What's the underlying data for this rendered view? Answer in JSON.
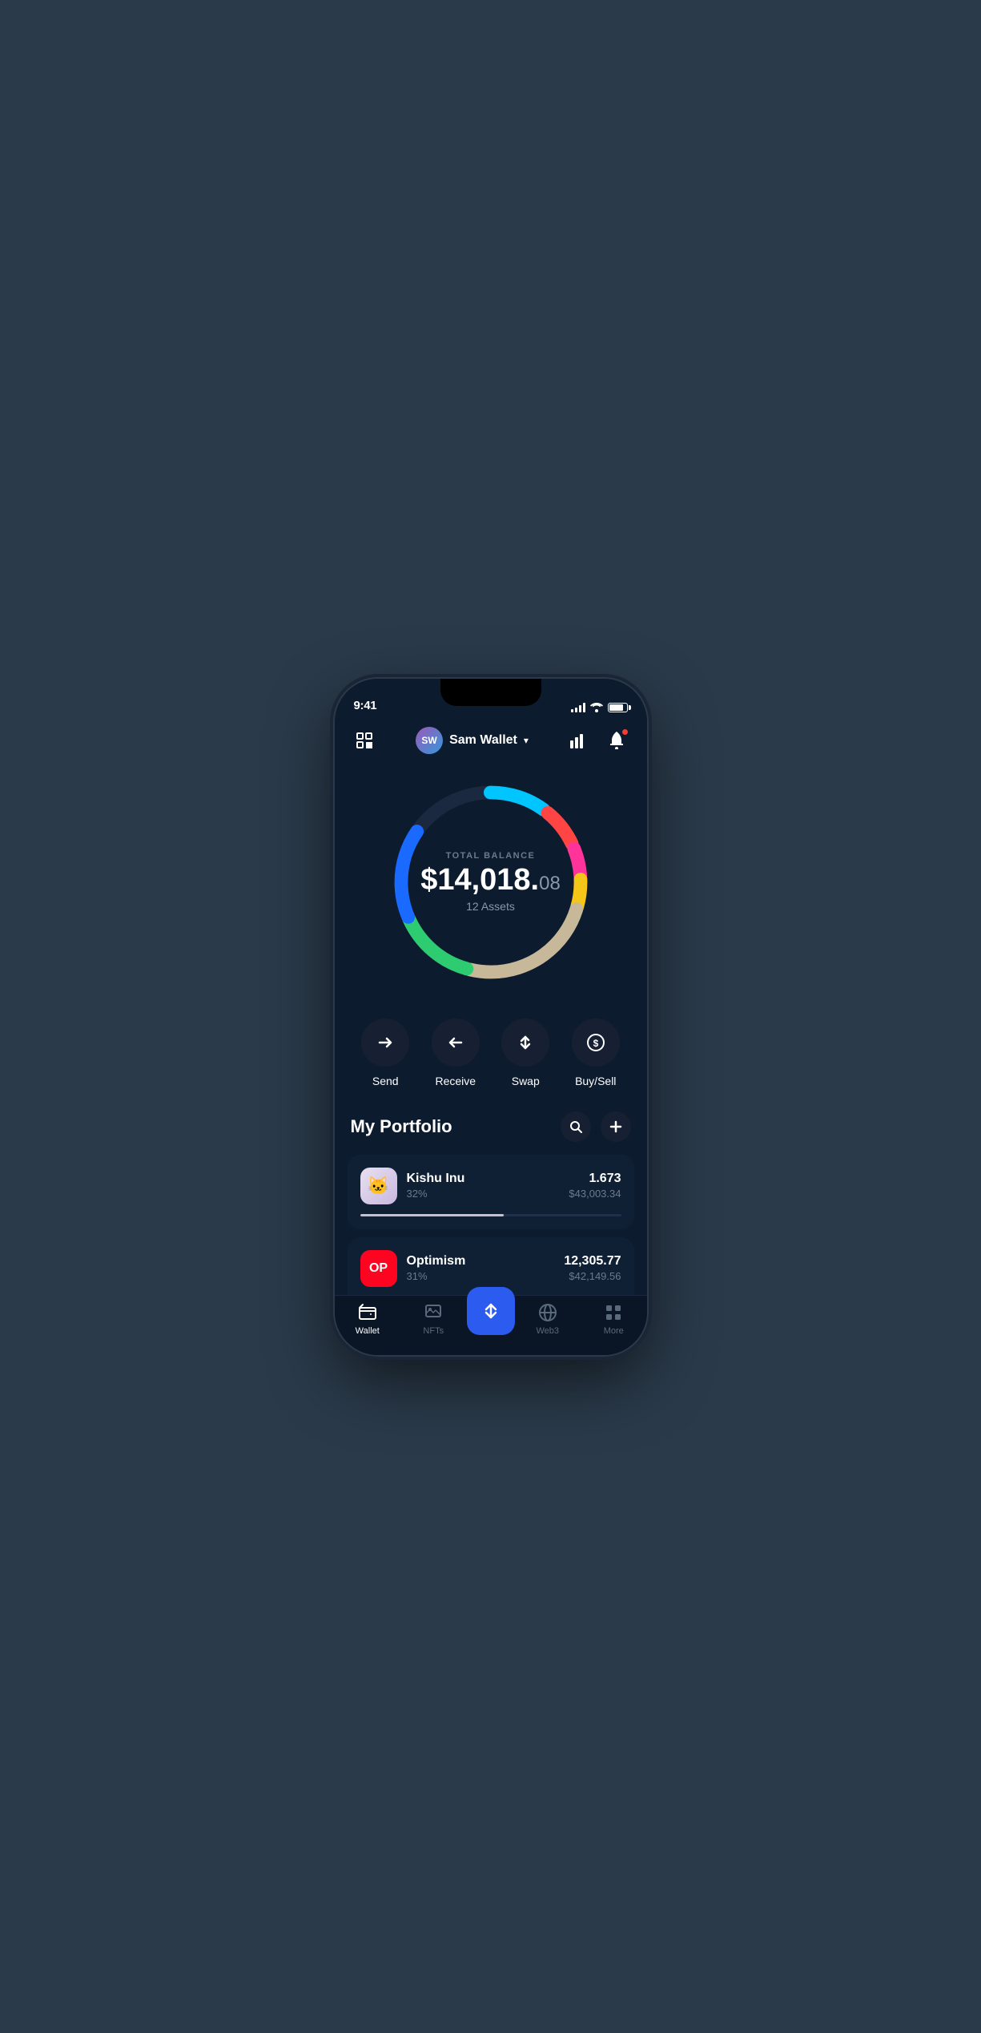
{
  "statusBar": {
    "time": "9:41",
    "batteryLevel": 85
  },
  "header": {
    "scanLabel": "scan",
    "walletName": "Sam Wallet",
    "avatarInitials": "SW",
    "analyticsLabel": "analytics",
    "notificationsLabel": "notifications"
  },
  "chart": {
    "balanceLabel": "TOTAL BALANCE",
    "balanceWhole": "$14,018.",
    "balanceCents": "08",
    "assetsLabel": "12 Assets",
    "segments": [
      {
        "color": "#ff4444",
        "percent": 8
      },
      {
        "color": "#ff69b4",
        "percent": 6
      },
      {
        "color": "#f5c518",
        "percent": 6
      },
      {
        "color": "#c8b89a",
        "percent": 32
      },
      {
        "color": "#2ecc71",
        "percent": 16
      },
      {
        "color": "#1a8cff",
        "percent": 20
      },
      {
        "color": "#00c5ff",
        "percent": 12
      }
    ]
  },
  "actions": [
    {
      "id": "send",
      "label": "Send",
      "icon": "→"
    },
    {
      "id": "receive",
      "label": "Receive",
      "icon": "←"
    },
    {
      "id": "swap",
      "label": "Swap",
      "icon": "⇅"
    },
    {
      "id": "buysell",
      "label": "Buy/Sell",
      "icon": "$"
    }
  ],
  "portfolio": {
    "title": "My Portfolio",
    "searchLabel": "search",
    "addLabel": "add",
    "items": [
      {
        "id": "kishu",
        "name": "Kishu Inu",
        "percentage": "32%",
        "amount": "1.673",
        "usdValue": "$43,003.34",
        "progressColor": "#c8c0d0",
        "progressWidth": 55,
        "iconType": "kishu"
      },
      {
        "id": "optimism",
        "name": "Optimism",
        "percentage": "31%",
        "amount": "12,305.77",
        "usdValue": "$42,149.56",
        "progressColor": "#ff4444",
        "progressWidth": 52,
        "iconType": "op"
      }
    ]
  },
  "bottomNav": {
    "items": [
      {
        "id": "wallet",
        "label": "Wallet",
        "active": true,
        "iconType": "wallet"
      },
      {
        "id": "nfts",
        "label": "NFTs",
        "active": false,
        "iconType": "nfts"
      },
      {
        "id": "swap-center",
        "label": "",
        "active": false,
        "iconType": "swap-center"
      },
      {
        "id": "web3",
        "label": "Web3",
        "active": false,
        "iconType": "web3"
      },
      {
        "id": "more",
        "label": "More",
        "active": false,
        "iconType": "more"
      }
    ]
  }
}
